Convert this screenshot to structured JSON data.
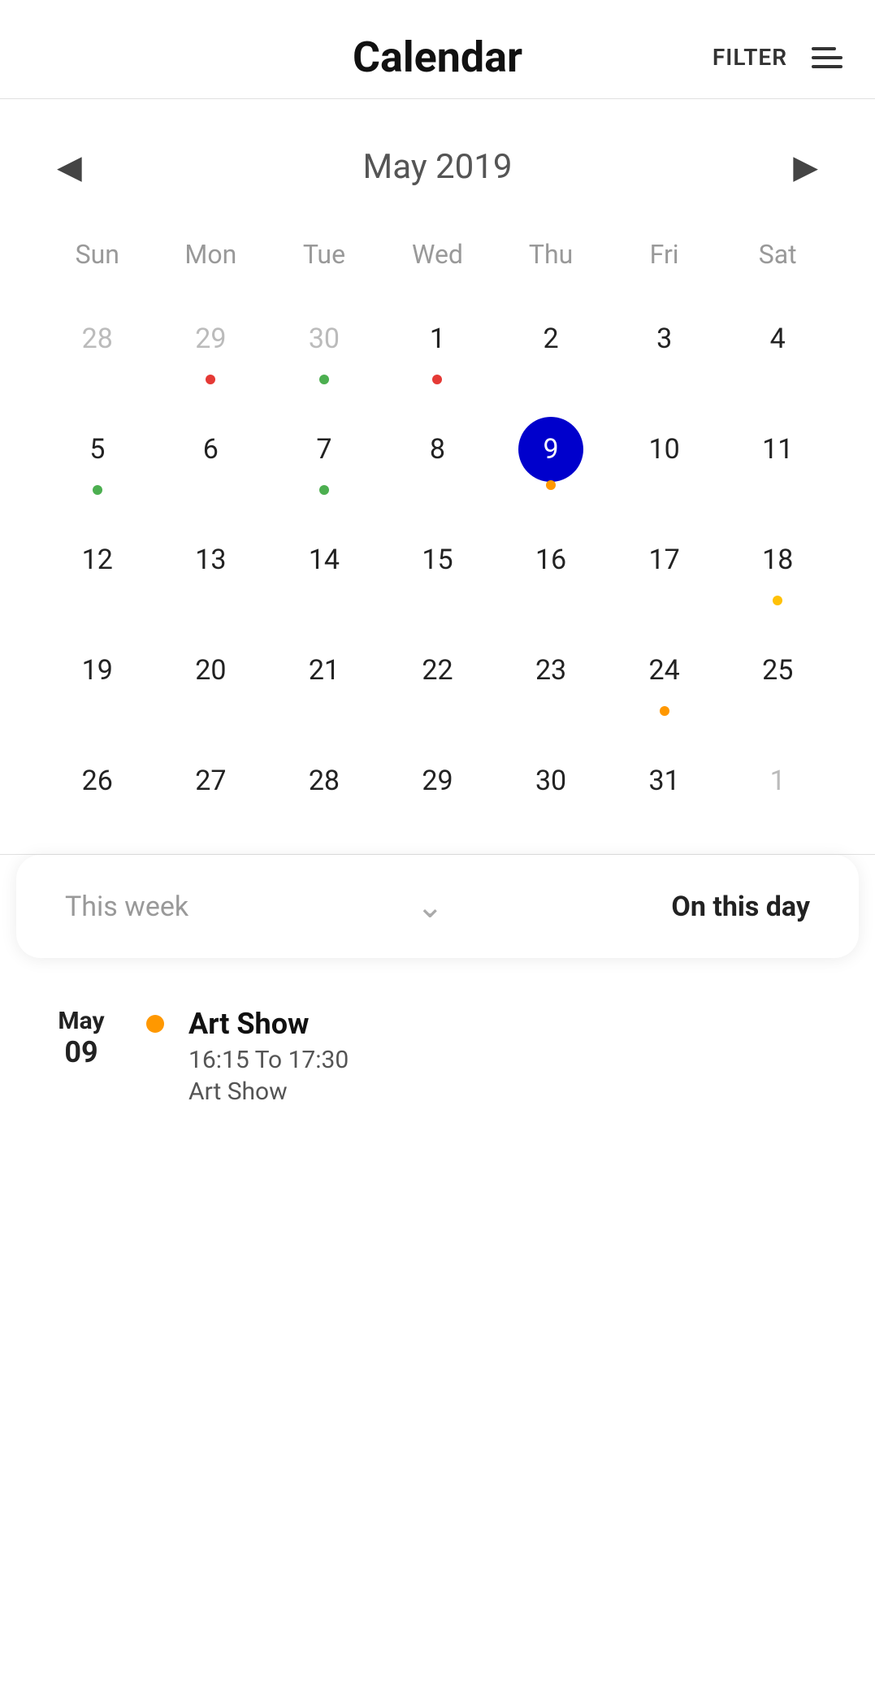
{
  "header": {
    "title": "Calendar",
    "filter_label": "FILTER"
  },
  "calendar": {
    "month_title": "May 2019",
    "weekdays": [
      "Sun",
      "Mon",
      "Tue",
      "Wed",
      "Thu",
      "Fri",
      "Sat"
    ],
    "days": [
      {
        "number": "28",
        "other_month": true,
        "dots": [],
        "selected": false
      },
      {
        "number": "29",
        "other_month": true,
        "dots": [
          "red"
        ],
        "selected": false
      },
      {
        "number": "30",
        "other_month": true,
        "dots": [
          "green"
        ],
        "selected": false
      },
      {
        "number": "1",
        "other_month": false,
        "dots": [
          "red"
        ],
        "selected": false
      },
      {
        "number": "2",
        "other_month": false,
        "dots": [],
        "selected": false
      },
      {
        "number": "3",
        "other_month": false,
        "dots": [],
        "selected": false
      },
      {
        "number": "4",
        "other_month": false,
        "dots": [],
        "selected": false
      },
      {
        "number": "5",
        "other_month": false,
        "dots": [
          "green"
        ],
        "selected": false
      },
      {
        "number": "6",
        "other_month": false,
        "dots": [],
        "selected": false
      },
      {
        "number": "7",
        "other_month": false,
        "dots": [
          "green"
        ],
        "selected": false
      },
      {
        "number": "8",
        "other_month": false,
        "dots": [],
        "selected": false
      },
      {
        "number": "9",
        "other_month": false,
        "dots": [
          "orange"
        ],
        "selected": true
      },
      {
        "number": "10",
        "other_month": false,
        "dots": [],
        "selected": false
      },
      {
        "number": "11",
        "other_month": false,
        "dots": [],
        "selected": false
      },
      {
        "number": "12",
        "other_month": false,
        "dots": [],
        "selected": false
      },
      {
        "number": "13",
        "other_month": false,
        "dots": [],
        "selected": false
      },
      {
        "number": "14",
        "other_month": false,
        "dots": [],
        "selected": false
      },
      {
        "number": "15",
        "other_month": false,
        "dots": [],
        "selected": false
      },
      {
        "number": "16",
        "other_month": false,
        "dots": [],
        "selected": false
      },
      {
        "number": "17",
        "other_month": false,
        "dots": [],
        "selected": false
      },
      {
        "number": "18",
        "other_month": false,
        "dots": [
          "yellow"
        ],
        "selected": false
      },
      {
        "number": "19",
        "other_month": false,
        "dots": [],
        "selected": false
      },
      {
        "number": "20",
        "other_month": false,
        "dots": [],
        "selected": false
      },
      {
        "number": "21",
        "other_month": false,
        "dots": [],
        "selected": false
      },
      {
        "number": "22",
        "other_month": false,
        "dots": [],
        "selected": false
      },
      {
        "number": "23",
        "other_month": false,
        "dots": [],
        "selected": false
      },
      {
        "number": "24",
        "other_month": false,
        "dots": [
          "orange"
        ],
        "selected": false
      },
      {
        "number": "25",
        "other_month": false,
        "dots": [],
        "selected": false
      },
      {
        "number": "26",
        "other_month": false,
        "dots": [],
        "selected": false
      },
      {
        "number": "27",
        "other_month": false,
        "dots": [],
        "selected": false
      },
      {
        "number": "28",
        "other_month": false,
        "dots": [],
        "selected": false
      },
      {
        "number": "29",
        "other_month": false,
        "dots": [],
        "selected": false
      },
      {
        "number": "30",
        "other_month": false,
        "dots": [],
        "selected": false
      },
      {
        "number": "31",
        "other_month": false,
        "dots": [],
        "selected": false
      },
      {
        "number": "1",
        "other_month": true,
        "dots": [],
        "selected": false
      }
    ]
  },
  "filter_bar": {
    "this_week": "This week",
    "on_this_day": "On this day"
  },
  "events": [
    {
      "month": "May",
      "day": "09",
      "dot_color": "orange",
      "title": "Art Show",
      "time": "16:15 To 17:30",
      "description": "Art Show"
    }
  ]
}
